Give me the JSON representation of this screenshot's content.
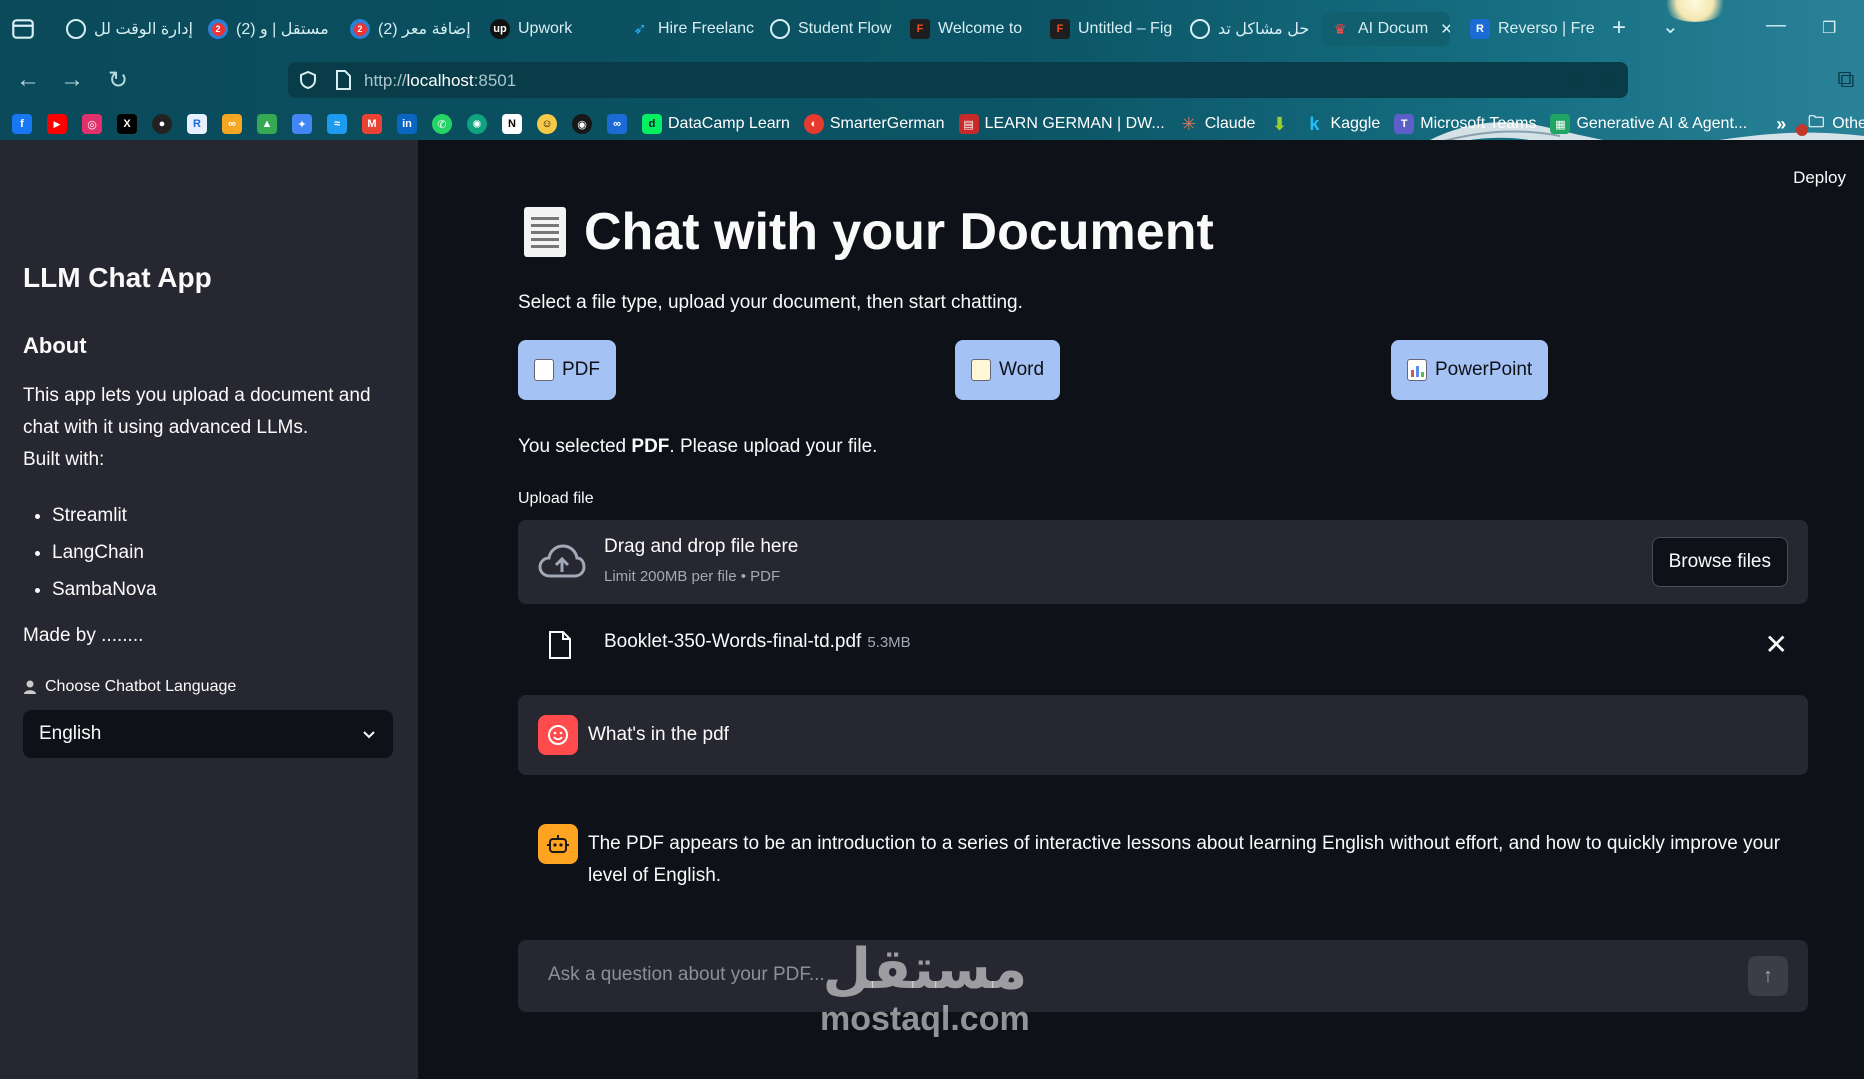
{
  "browser": {
    "tabs": [
      {
        "label": "إدارة الوقت لل",
        "icon": "chatgpt-icon"
      },
      {
        "label": "(2) مستقل | و",
        "icon": "mostaql-icon",
        "badge": "2"
      },
      {
        "label": "(2) إضافة معر",
        "icon": "mostaql-icon",
        "badge": "2"
      },
      {
        "label": "Upwork",
        "icon": "upwork-icon"
      },
      {
        "label": "Hire Freelanc",
        "icon": "freelancer-icon"
      },
      {
        "label": "Student Flow",
        "icon": "chatgpt-icon"
      },
      {
        "label": "Welcome to",
        "icon": "figma-icon"
      },
      {
        "label": "Untitled – Fig",
        "icon": "figma-icon"
      },
      {
        "label": "حل مشاكل تد",
        "icon": "chatgpt-icon"
      },
      {
        "label": "AI Docum",
        "icon": "streamlit-icon",
        "active": true
      },
      {
        "label": "Reverso | Fre",
        "icon": "reverso-icon"
      }
    ],
    "url": {
      "scheme": "http://",
      "host": "localhost",
      "port": ":8501"
    },
    "bookmarks": [
      {
        "label": "DataCamp Learn",
        "icon": "datacamp-icon",
        "color": "#03ef62"
      },
      {
        "label": "SmarterGerman",
        "icon": "smartergerman-icon",
        "color": "#e63b2e"
      },
      {
        "label": "LEARN GERMAN | DW...",
        "icon": "dw-icon",
        "color": "#c82a2a"
      },
      {
        "label": "Claude",
        "icon": "claude-icon",
        "color": "#d97757"
      },
      {
        "label": "Kaggle",
        "icon": "kaggle-icon",
        "color": "#20beff"
      },
      {
        "label": "Microsoft Teams",
        "icon": "teams-icon",
        "color": "#5b5fc7"
      },
      {
        "label": "Generative AI & Agent...",
        "icon": "sheet-icon",
        "color": "#1fa463"
      }
    ],
    "other_bookmarks": "Other Book"
  },
  "sidebar": {
    "title": "LLM Chat App",
    "about_heading": "About",
    "about_text": "This app lets you upload a document and chat with it using advanced LLMs.",
    "built_with": "Built with:",
    "tools": [
      "Streamlit",
      "LangChain",
      "SambaNova"
    ],
    "made_by": "Made by ........",
    "language_label": "Choose Chatbot Language",
    "language_value": "English"
  },
  "main": {
    "deploy": "Deploy",
    "title": "Chat with your Document",
    "subtitle": "Select a file type, upload your document, then start chatting.",
    "file_types": [
      "PDF",
      "Word",
      "PowerPoint"
    ],
    "selected_prefix": "You selected ",
    "selected_type": "PDF",
    "selected_suffix": ". Please upload your file.",
    "upload_label": "Upload file",
    "drop_main": "Drag and drop file here",
    "drop_sub": "Limit 200MB per file • PDF",
    "browse": "Browse files",
    "file_name": "Booklet-350-Words-final-td.pdf",
    "file_size": "5.3MB",
    "user_message": "What's in the pdf",
    "bot_message": "The PDF appears to be an introduction to a series of interactive lessons about learning English without effort, and how to quickly improve your level of English.",
    "chat_placeholder": "Ask a question about your PDF..."
  },
  "watermark": {
    "arabic": "مستقل",
    "latin": "mostaql.com"
  },
  "colors": {
    "sidebar_bg": "#262730",
    "main_bg": "#0e1117",
    "button_bg": "#a5c2f5",
    "user_avatar": "#ff4b4b",
    "bot_avatar": "#ffa421",
    "chrome": "#0b5566"
  }
}
